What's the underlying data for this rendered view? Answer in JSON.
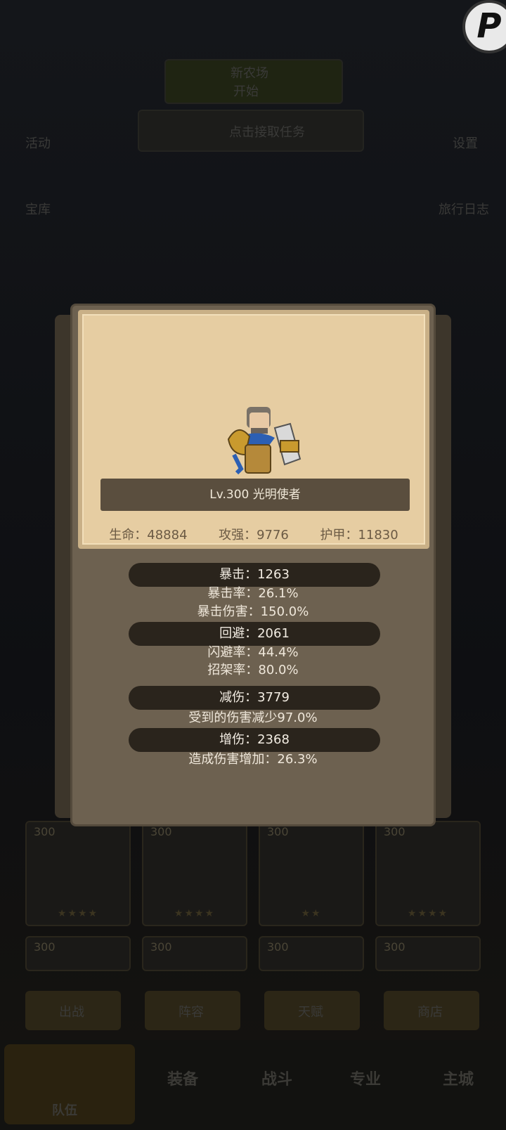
{
  "background": {
    "top_banner": {
      "line1": "新农场",
      "line2": "开始"
    },
    "task_button": "点击接取任务",
    "left_icons": [
      "活动",
      "宝库"
    ],
    "right_icons": [
      "设置",
      "旅行日志"
    ],
    "card_level": "300",
    "card_stars": [
      "★★★★",
      "★★★★",
      "★★",
      "★★★★"
    ],
    "buttons": [
      "出战",
      "阵容",
      "天赋",
      "商店"
    ],
    "nav_items": [
      "队伍",
      "装备",
      "战斗",
      "专业",
      "主城"
    ]
  },
  "corner_button": "P",
  "modal": {
    "hero_name": "Lv.300 光明使者",
    "stats": {
      "hp": "生命：48884",
      "atk": "攻强：9776",
      "armor": "护甲：11830"
    },
    "sections": [
      {
        "header": "暴击：1263",
        "lines": [
          "暴击率：26.1%",
          "暴击伤害：150.0%"
        ]
      },
      {
        "header": "回避：2061",
        "lines": [
          "闪避率：44.4%",
          "招架率：80.0%"
        ]
      },
      {
        "header": "减伤：3779",
        "lines": [
          "受到的伤害减少97.0%"
        ]
      },
      {
        "header": "增伤：2368",
        "lines": [
          "造成伤害增加：26.3%"
        ]
      }
    ]
  }
}
